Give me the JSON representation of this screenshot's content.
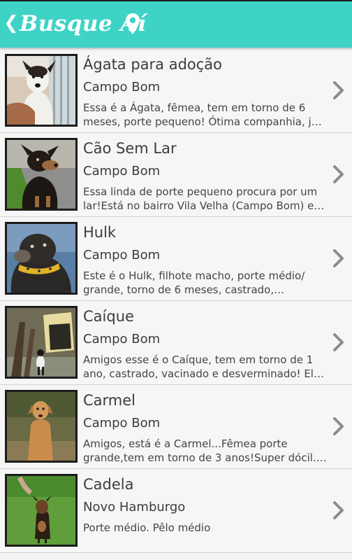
{
  "header": {
    "title": "Busque Aí",
    "back_icon": "chevron-left-icon",
    "location_icon": "location-pin-icon",
    "color": "#3fd3c6"
  },
  "pets": [
    {
      "name": "Ágata para adoção",
      "city": "Campo Bom",
      "description": "Essa é a Ágata, fêmea, tem em torno de 6 meses, porte pequeno! Ótima companhia, já ..."
    },
    {
      "name": "Cão Sem Lar",
      "city": "Campo Bom",
      "description": "Essa linda de porte pequeno procura por um lar!Está no bairro Vila Velha (Campo Bom) e v..."
    },
    {
      "name": "Hulk",
      "city": "Campo Bom",
      "description": "Este é o Hulk, filhote macho, porte médio/ grande, torno de 6 meses, castrado, vacinad..."
    },
    {
      "name": "Caíque",
      "city": "Campo Bom",
      "description": "Amigos esse é o Caíque, tem em torno de 1 ano, castrado, vacinado e desverminado! Ele ..."
    },
    {
      "name": "Carmel",
      "city": "Campo Bom",
      "description": "Amigos, está é a Carmel...Fêmea porte grande,tem em torno de 3 anos!Super dócil. ..."
    },
    {
      "name": "Cadela",
      "city": "Novo Hamburgo",
      "description": "Porte médio. Pêlo médio"
    }
  ]
}
